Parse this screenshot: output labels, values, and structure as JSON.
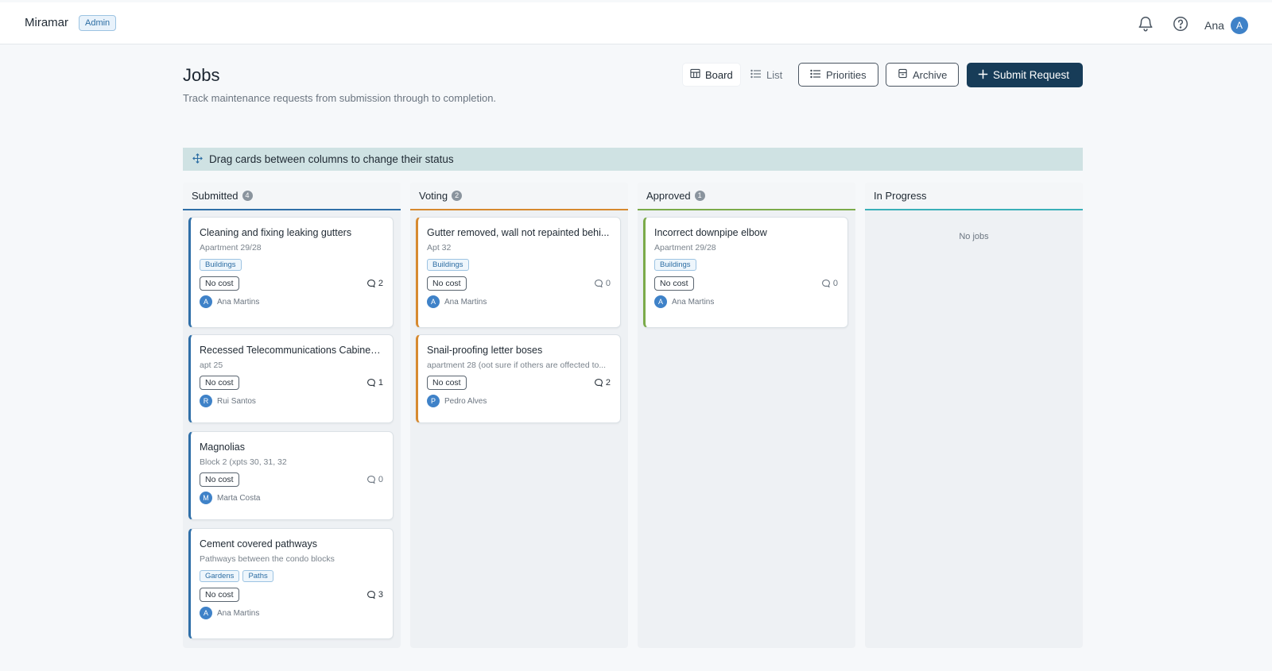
{
  "header": {
    "brand": "Miramar",
    "role_badge": "Admin",
    "user_name": "Ana",
    "user_initial": "A",
    "icons": [
      "bell-icon",
      "help-icon"
    ]
  },
  "page": {
    "title": "Jobs",
    "subtitle": "Track maintenance requests from submission through to completion."
  },
  "toolbar": {
    "board_label": "Board",
    "list_label": "List",
    "priorities_label": "Priorities",
    "archive_label": "Archive",
    "submit_label": "Submit Request"
  },
  "hint": "Drag cards between columns to change their status",
  "colors": {
    "submitted": "#2f6fa8",
    "voting": "#d6892f",
    "approved": "#7bab4a",
    "in_progress": "#3ab0b8",
    "primary": "#173c58"
  },
  "columns": [
    {
      "name": "Submitted",
      "count": "4",
      "cards": [
        {
          "title": "Cleaning and fixing leaking gutters",
          "subtitle": "Apartment 29/28",
          "tags": [
            "Buildings"
          ],
          "cost": "No cost",
          "comments": "2",
          "assignee": "Ana Martins",
          "initial": "A"
        },
        {
          "title": "Recessed Telecommunications Cabinet ...",
          "subtitle": "apt 25",
          "tags": [],
          "cost": "No cost",
          "comments": "1",
          "assignee": "Rui Santos",
          "initial": "R"
        },
        {
          "title": "Magnolias",
          "subtitle": "Block 2 (xpts 30, 31, 32",
          "tags": [],
          "cost": "No cost",
          "comments": "0",
          "assignee": "Marta Costa",
          "initial": "M"
        },
        {
          "title": "Cement covered pathways",
          "subtitle": "Pathways between the condo blocks",
          "tags": [
            "Gardens",
            "Paths"
          ],
          "cost": "No cost",
          "comments": "3",
          "assignee": "Ana Martins",
          "initial": "A"
        }
      ]
    },
    {
      "name": "Voting",
      "count": "2",
      "cards": [
        {
          "title": "Gutter removed, wall not repainted behi...",
          "subtitle": "Apt 32",
          "tags": [
            "Buildings"
          ],
          "cost": "No cost",
          "comments": "0",
          "assignee": "Ana Martins",
          "initial": "A"
        },
        {
          "title": "Snail-proofing letter boses",
          "subtitle": "apartment 28 (oot sure if others are offected to...",
          "tags": [],
          "cost": "No cost",
          "comments": "2",
          "assignee": "Pedro Alves",
          "initial": "P"
        }
      ]
    },
    {
      "name": "Approved",
      "count": "1",
      "cards": [
        {
          "title": "Incorrect downpipe elbow",
          "subtitle": "Apartment 29/28",
          "tags": [
            "Buildings"
          ],
          "cost": "No cost",
          "comments": "0",
          "assignee": "Ana Martins",
          "initial": "A"
        }
      ]
    },
    {
      "name": "In Progress",
      "count": "",
      "empty_text": "No jobs",
      "cards": []
    }
  ]
}
